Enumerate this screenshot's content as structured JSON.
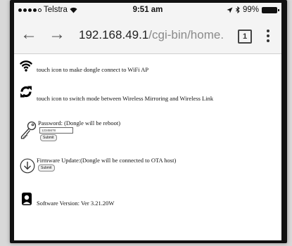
{
  "status_bar": {
    "carrier": "Telstra",
    "time": "9:51 am",
    "battery_percent": "99%"
  },
  "browser": {
    "url_host": "192.168.49.1",
    "url_path": "/cgi-bin/home.c",
    "tab_count": "1"
  },
  "page": {
    "wifi_text": "touch icon to make dongle connect to WiFi AP",
    "switch_text": "touch icon to switch mode between Wireless Mirroring and Wireless Link",
    "password_label": "Password: (Dongle will be reboot)",
    "password_value": "12345678",
    "password_button": "Submit",
    "firmware_label": "Firmware Update:(Dongle will be connected to OTA host)",
    "firmware_button": "Submit",
    "software_version": "Software Version: Ver 3.21.20W"
  }
}
